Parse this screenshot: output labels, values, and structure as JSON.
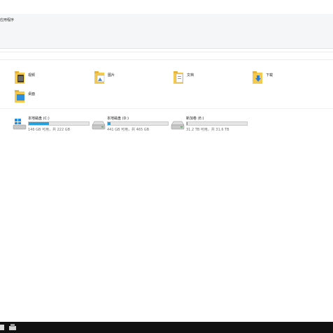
{
  "ribbon": {
    "tab_label": "应用程序"
  },
  "folders": [
    {
      "label": "视频",
      "icon": "video-folder-icon"
    },
    {
      "label": "图片",
      "icon": "pictures-folder-icon"
    },
    {
      "label": "文档",
      "icon": "documents-folder-icon"
    },
    {
      "label": "下载",
      "icon": "downloads-folder-icon"
    },
    {
      "label": "桌面",
      "icon": "desktop-folder-icon"
    }
  ],
  "drives": [
    {
      "name": "本地磁盘 (C:)",
      "info": "146 GB 可用，共 222 GB",
      "used_fraction": 0.34,
      "icon": "windows-drive-icon"
    },
    {
      "name": "本地磁盘 (D:)",
      "info": "441 GB 可用，共 465 GB",
      "used_fraction": 0.05,
      "icon": "hard-drive-icon"
    },
    {
      "name": "新加卷 (E:)",
      "info": "31.2 TB 可用，共 31.6 TB",
      "used_fraction": 0.01,
      "icon": "hard-drive-icon"
    }
  ],
  "colors": {
    "bar_fill": "#26a0da",
    "taskbar": "#101010",
    "folder_yellow": "#f4c94f"
  }
}
